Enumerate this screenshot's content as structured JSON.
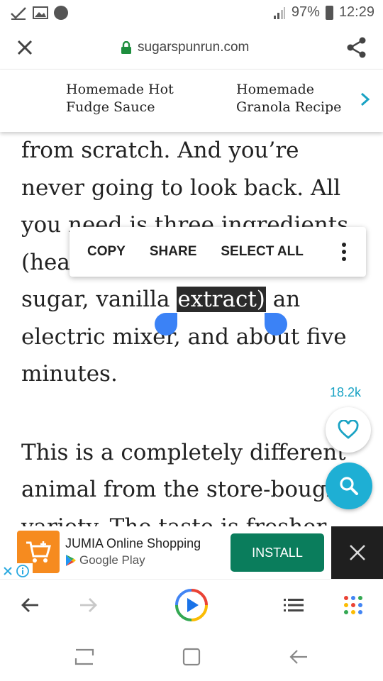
{
  "status_bar": {
    "battery": "97%",
    "time": "12:29",
    "icons": [
      "check-icon",
      "image-icon",
      "circle-icon",
      "signal-icon",
      "battery-icon"
    ]
  },
  "url_bar": {
    "domain": "sugarspunrun.com",
    "lock_color": "#1e8e3e"
  },
  "related": {
    "items": [
      {
        "label_line1": "Homemade Hot",
        "label_line2": "Fudge Sauce"
      },
      {
        "label_line1": "Homemade",
        "label_line2": "Granola Recipe"
      }
    ],
    "accent": "#1aa3c4"
  },
  "article": {
    "p1": {
      "l1": "from scratch. And you’re",
      "l2": "never going to look back. All",
      "l3": "you need is three ingredients",
      "l4": "(heavy cream, powdered",
      "l5a": "sugar, vanilla ",
      "l5b": "extract)",
      "l5c": " an",
      "l6": "electric mixer, and about five",
      "l7": "minutes."
    },
    "p2": {
      "l1": "This is a completely different",
      "l2": "animal from the store-bought",
      "l3": "variety. The taste is fresher,"
    }
  },
  "context_menu": {
    "copy": "COPY",
    "share": "SHARE",
    "select_all": "SELECT ALL"
  },
  "likes": {
    "count": "18.2k"
  },
  "ad": {
    "title": "JUMIA Online Shopping",
    "store": "Google Play",
    "install": "INSTALL",
    "install_color": "#0a7d5c",
    "logo_color": "#f68b1f"
  },
  "colors": {
    "handle": "#3b82f6",
    "search_fab": "#1eafd4"
  }
}
